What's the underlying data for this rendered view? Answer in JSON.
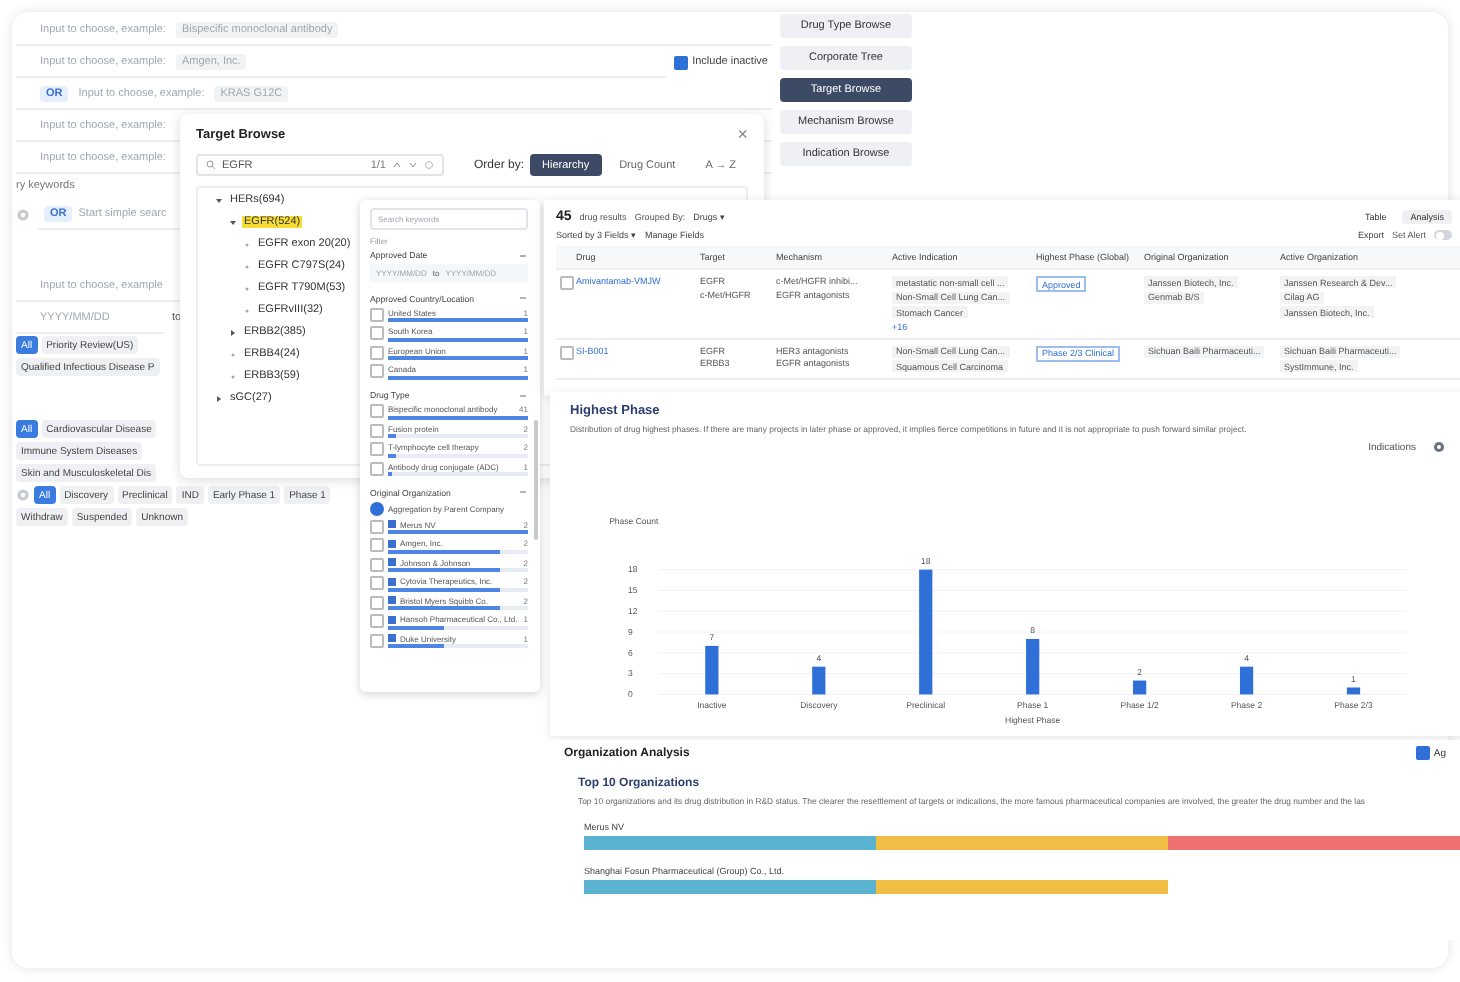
{
  "form": {
    "sections": [
      {
        "rows": [
          {
            "kind": "input",
            "placeholder": "Input to choose, example:",
            "example": "Bispecific monoclonal antibody"
          },
          {
            "kind": "input",
            "placeholder": "Input to choose, example:",
            "example": "Amgen, Inc.",
            "option": {
              "label": "Include inactive",
              "checked": true
            }
          },
          {
            "kind": "input",
            "logic": "OR",
            "placeholder": "Input to choose, example:",
            "example": "KRAS G12C"
          },
          {
            "kind": "input",
            "placeholder": "Input to choose, example:"
          },
          {
            "kind": "input",
            "placeholder": "Input to choose, example:"
          },
          {
            "kind": "label",
            "text": "ry keywords"
          },
          {
            "kind": "search",
            "logic": "OR",
            "placeholder": "Start simple searc"
          }
        ]
      },
      {
        "rows": [
          {
            "kind": "input",
            "placeholder": "Input to choose, example"
          },
          {
            "kind": "date",
            "placeholder": "YYYY/MM/DD",
            "joiner": "to"
          },
          {
            "kind": "chips",
            "chips": [
              {
                "label": "All",
                "selected": true
              },
              {
                "label": "Priority Review(US)",
                "selected": false
              }
            ]
          },
          {
            "kind": "chips",
            "chips": [
              {
                "label": "Qualified Infectious Disease P",
                "selected": false
              }
            ]
          }
        ]
      },
      {
        "rows": [
          {
            "kind": "chips",
            "chips": [
              {
                "label": "All",
                "selected": true
              },
              {
                "label": "Cardiovascular Disease",
                "selected": false
              }
            ]
          },
          {
            "kind": "chips",
            "chips": [
              {
                "label": "Immune System Diseases",
                "selected": false
              }
            ]
          },
          {
            "kind": "chips",
            "chips": [
              {
                "label": "Skin and Musculoskeletal Dis",
                "selected": false
              }
            ]
          },
          {
            "kind": "phase-chips",
            "chips": [
              {
                "label": "All",
                "selected": true
              },
              {
                "label": "Discovery",
                "selected": false
              },
              {
                "label": "Preclinical",
                "selected": false
              },
              {
                "label": "IND",
                "selected": false
              },
              {
                "label": "Early Phase 1",
                "selected": false
              },
              {
                "label": "Phase 1",
                "selected": false
              }
            ]
          },
          {
            "kind": "chips",
            "chips": [
              {
                "label": "Withdraw",
                "selected": false
              },
              {
                "label": "Suspended",
                "selected": false
              },
              {
                "label": "Unknown",
                "selected": false
              }
            ]
          }
        ]
      }
    ]
  },
  "browse_buttons": [
    {
      "label": "Drug Type Browse",
      "selected": false
    },
    {
      "label": "Corporate Tree",
      "selected": false
    },
    {
      "label": "Target Browse",
      "selected": true
    },
    {
      "label": "Mechanism Browse",
      "selected": false
    },
    {
      "label": "Indication Browse",
      "selected": false
    }
  ],
  "dialog": {
    "title": "Target Browse",
    "close": "×",
    "search": {
      "value": "EGFR",
      "match": "1/1"
    },
    "order_label": "Order by:",
    "order_options": [
      {
        "label": "Hierarchy",
        "selected": true
      },
      {
        "label": "Drug Count",
        "selected": false
      },
      {
        "label": "A → Z",
        "selected": false
      }
    ],
    "tree": [
      {
        "label": "HERs(694)",
        "expanded": true,
        "selected": false,
        "children": [
          {
            "label": "EGFR(524)",
            "expanded": true,
            "selected": true,
            "children": [
              {
                "label": "EGFR exon 20(20)",
                "selected": false
              },
              {
                "label": "EGFR C797S(24)",
                "selected": false
              },
              {
                "label": "EGFR T790M(53)",
                "selected": false
              },
              {
                "label": "EGFRvIII(32)",
                "selected": false
              }
            ]
          },
          {
            "label": "ERBB2(385)",
            "expanded": false,
            "selected": false
          },
          {
            "label": "ERBB4(24)",
            "selected": false
          },
          {
            "label": "ERBB3(59)",
            "selected": false
          }
        ]
      },
      {
        "label": "sGC(27)",
        "expanded": false,
        "selected": false
      }
    ]
  },
  "filter": {
    "placeholder": "Search keywords",
    "heading": "Filter",
    "groups": [
      {
        "kind": "date",
        "title": "Approved Date",
        "from": "YYYY/MM/DD",
        "joiner": "to",
        "to": "YYYY/MM/DD"
      },
      {
        "kind": "list",
        "title": "Approved Country/Location",
        "options": [
          {
            "label": "United States",
            "count": "1",
            "checked": false,
            "level": 1
          },
          {
            "label": "South Korea",
            "count": "1",
            "checked": false,
            "level": 1
          },
          {
            "label": "European Union",
            "count": "1",
            "checked": false,
            "level": 1
          },
          {
            "label": "Canada",
            "count": "1",
            "checked": false,
            "level": 1
          }
        ]
      },
      {
        "kind": "list",
        "title": "Drug Type",
        "options": [
          {
            "label": "Bispecific monoclonal antibody",
            "count": "41",
            "checked": false,
            "level": 1
          },
          {
            "label": "Fusion protein",
            "count": "2",
            "checked": false,
            "level": 0.05
          },
          {
            "label": "T-lymphocyte cell therapy",
            "count": "2",
            "checked": false,
            "level": 0.05
          },
          {
            "label": "Antibody drug conjugate (ADC)",
            "count": "1",
            "checked": false,
            "level": 0.03
          }
        ]
      },
      {
        "kind": "org",
        "title": "Original Organization",
        "aggregate": {
          "label": "Aggregation by Parent Company",
          "checked": true
        },
        "options": [
          {
            "label": "Merus NV",
            "count": "2",
            "checked": false,
            "level": 1
          },
          {
            "label": "Amgen, Inc.",
            "count": "2",
            "checked": false,
            "level": 0.8
          },
          {
            "label": "Johnson & Johnson",
            "count": "2",
            "checked": false,
            "level": 0.8
          },
          {
            "label": "Cytovia Therapeutics, Inc.",
            "count": "2",
            "checked": false,
            "level": 0.8
          },
          {
            "label": "Bristol Myers Squibb Co.",
            "count": "2",
            "checked": false,
            "level": 0.8
          },
          {
            "label": "Hansoh Pharmaceutical Co., Ltd.",
            "count": "1",
            "checked": false,
            "level": 0.4
          },
          {
            "label": "Duke University",
            "count": "1",
            "checked": false,
            "level": 0.4
          }
        ]
      }
    ]
  },
  "results": {
    "count": "45",
    "count_label": "drug results",
    "grouped_label": "Grouped By:",
    "grouped_value": "Drugs ▾",
    "sort": "Sorted by 3 Fields ▾",
    "manage": "Manage Fields",
    "views": [
      {
        "label": "Table",
        "selected": false
      },
      {
        "label": "Analysis",
        "selected": true
      }
    ],
    "export": "Export",
    "alert": {
      "label": "Set Alert",
      "on": false
    },
    "columns": [
      "Drug",
      "Target",
      "Mechanism",
      "Active Indication",
      "Highest Phase (Global)",
      "Original Organization",
      "Active Organization"
    ],
    "rows": [
      {
        "checked": false,
        "drug": "Amivantamab-VMJW",
        "targets": [
          "EGFR",
          "c-Met/HGFR"
        ],
        "mechanisms": [
          "c-Met/HGFR inhibi...",
          "EGFR antagonists"
        ],
        "indications": [
          "metastatic non-small cell ...",
          "Non-Small Cell Lung Can...",
          "Stomach Cancer"
        ],
        "more": "+16",
        "phase": "Approved",
        "original": [
          "Janssen Biotech, Inc.",
          "Genmab B/S"
        ],
        "active": [
          "Janssen Research & Dev...",
          "Cilag AG",
          "Janssen Biotech, Inc."
        ]
      },
      {
        "checked": false,
        "drug": "SI-B001",
        "targets": [
          "EGFR",
          "ERBB3"
        ],
        "mechanisms": [
          "HER3 antagonists",
          "EGFR antagonists"
        ],
        "indications": [
          "Non-Small Cell Lung Can...",
          "Squamous Cell Carcinoma"
        ],
        "phase": "Phase 2/3 Clinical",
        "original": [
          "Sichuan Baili Pharmaceuti..."
        ],
        "active": [
          "Sichuan Baili Pharmaceuti...",
          "SystImmune, Inc."
        ]
      }
    ]
  },
  "highest_phase": {
    "title": "Highest Phase",
    "description": "Distribution of drug highest phases. If there are many projects in later phase or approved, it implies fierce competitions in future and it is not appropriate to push forward similar project.",
    "selector": "Indications",
    "chart_data": {
      "type": "bar",
      "xlabel": "Highest Phase",
      "ylabel": "Phase Count",
      "categories": [
        "Inactive",
        "Discovery",
        "Preclinical",
        "Phase 1",
        "Phase 1/2",
        "Phase 2",
        "Phase 2/3"
      ],
      "series": [
        {
          "color": "#2f6fd8",
          "values": [
            7,
            4,
            18,
            8,
            2,
            4,
            1
          ]
        }
      ],
      "ylim": [
        0,
        18
      ],
      "yticks": [
        0,
        3,
        6,
        9,
        12,
        15,
        18
      ],
      "grid": true,
      "data_labels": true
    }
  },
  "organization": {
    "title": "Organization Analysis",
    "toggle": {
      "label": "Ag",
      "on": true
    },
    "subtitle": "Top 10 Organizations",
    "description": "Top 10 organizations and its drug distribution in R&D status. The clearer the resettlement of targets or indications, the more famous pharmaceutical companies are involved, the greater the drug number and the las",
    "bars": [
      {
        "name": "Merus NV",
        "segments": [
          {
            "color": "#5ab3d1"
          },
          {
            "color": "#f1bd45"
          },
          {
            "color": "#ee7070"
          }
        ]
      },
      {
        "name": "Shanghai Fosun Pharmaceutical (Group) Co., Ltd.",
        "segments": [
          {
            "color": "#5ab3d1"
          },
          {
            "color": "#f1bd45"
          }
        ]
      }
    ]
  }
}
